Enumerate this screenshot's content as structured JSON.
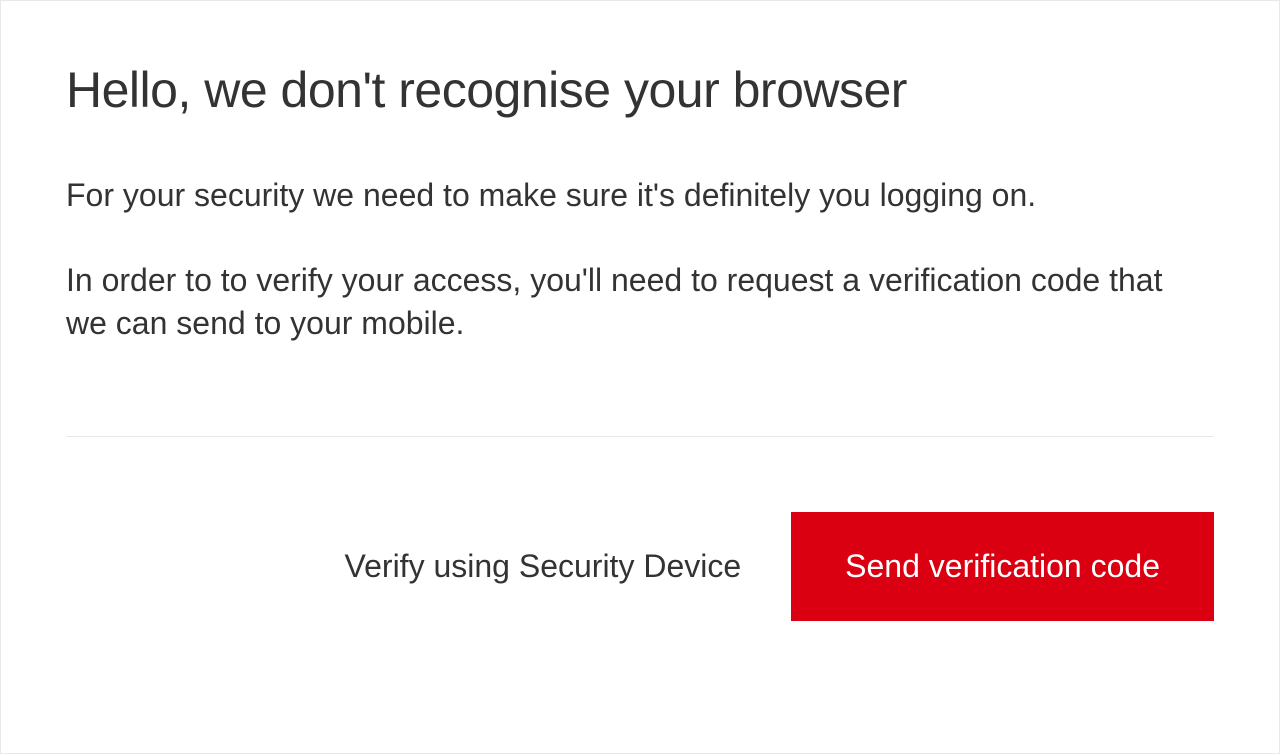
{
  "heading": "Hello, we don't recognise your browser",
  "paragraph1": "For your security we need to make sure it's definitely you logging on.",
  "paragraph2": "In order to to verify your access, you'll need to request a verification code that we can send to your mobile.",
  "actions": {
    "secondary_label": "Verify using Security Device",
    "primary_label": "Send verification code"
  },
  "colors": {
    "primary_button_bg": "#db0011",
    "text": "#333333",
    "divider": "#e8e8e8"
  }
}
